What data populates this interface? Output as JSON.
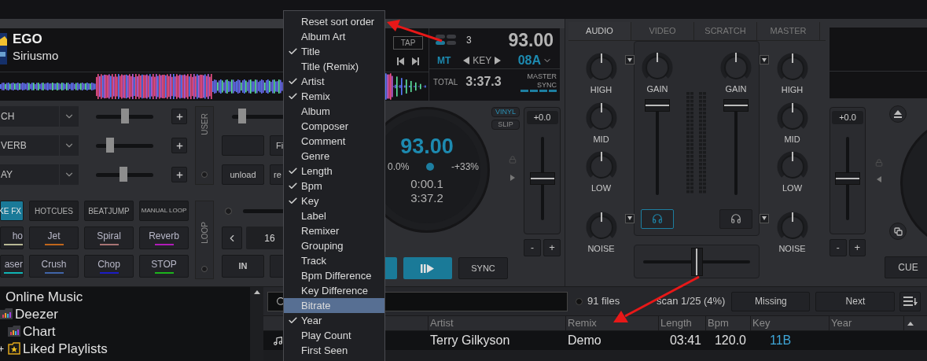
{
  "deck_left": {
    "title": "EGO",
    "artist": "Siriusmo",
    "tap": "TAP",
    "display": {
      "beats": "3",
      "bpm": "93.00",
      "mt": "MT",
      "key_label": "KEY",
      "key": "08A",
      "total_label": "TOTAL",
      "total": "3:37.3",
      "master_sync": "MASTER SYNC"
    },
    "fx_rows": [
      {
        "label": "CH",
        "level": 0.5
      },
      {
        "label": "VERB",
        "level": 0.2
      },
      {
        "label": "AY",
        "level": 0.47
      }
    ],
    "user_label": "USER",
    "side_slider": {
      "level": 0.05
    },
    "side_buttons": [
      "Fi",
      "unload",
      "re"
    ],
    "pad_modes": [
      {
        "label": "KE FX",
        "selected": true
      },
      {
        "label": "HOTCUES",
        "selected": false
      },
      {
        "label": "BEATJUMP",
        "selected": false
      },
      {
        "label": "MANUAL LOOP",
        "selected": false
      }
    ],
    "pads": [
      {
        "label": "ho",
        "color": "#b8b894"
      },
      {
        "label": "Jet",
        "color": "#c0661c"
      },
      {
        "label": "Spiral",
        "color": "#a87474"
      },
      {
        "label": "Reverb",
        "color": "#b01cb8"
      },
      {
        "label": "aser",
        "color": "#10b4b4"
      },
      {
        "label": "Crush",
        "color": "#4064a8"
      },
      {
        "label": "Chop",
        "color": "#1c1cc4"
      },
      {
        "label": "STOP",
        "color": "#1cb41c"
      }
    ],
    "loop_label": "LOOP",
    "loop_size": "16",
    "loop_in": "IN",
    "jog": {
      "bpm": "93.00",
      "pitch": "0.0%",
      "range": "-+33%",
      "elapsed": "0:00.1",
      "remain": "3:37.2"
    },
    "vinyl": {
      "label": "VINYL",
      "on": true
    },
    "slip": {
      "label": "SLIP",
      "on": false
    },
    "pitch": {
      "reading": "+0.0",
      "level": 0.5
    },
    "minus": "-",
    "plus": "+",
    "sync": "SYNC"
  },
  "mixer": {
    "tabs": [
      {
        "label": "AUDIO",
        "selected": true
      },
      {
        "label": "VIDEO",
        "selected": false
      },
      {
        "label": "SCRATCH",
        "selected": false
      },
      {
        "label": "MASTER",
        "selected": false
      }
    ],
    "eq_left": [
      "HIGH",
      "MID",
      "LOW",
      "NOISE"
    ],
    "eq_right": [
      "HIGH",
      "MID",
      "LOW",
      "NOISE"
    ],
    "channels": [
      {
        "gain_label": "GAIN",
        "level": 1,
        "headphones_on": true
      },
      {
        "gain_label": "GAIN",
        "level": 1,
        "headphones_on": false
      }
    ],
    "crossfader": {
      "level": 0.5
    }
  },
  "deck_right": {
    "pitch": {
      "reading": "+0.0",
      "level": 0.5
    },
    "minus": "-",
    "plus": "+",
    "cue": "CUE"
  },
  "browser": {
    "tree": [
      {
        "label": "Online Music",
        "children": [
          {
            "label": "Deezer",
            "kind": "chart-folder",
            "children": [
              {
                "label": "Chart",
                "kind": "chart-folder"
              },
              {
                "label": "Liked Playlists",
                "kind": "star-folder",
                "collapsed": true
              }
            ]
          }
        ]
      }
    ],
    "files": "91 files",
    "scan": "scan 1/25 (4%)",
    "buttons": [
      "Missing",
      "Next"
    ],
    "columns": [
      "Artist",
      "Remix",
      "Length",
      "Bpm",
      "Key",
      "Year"
    ],
    "rows": [
      {
        "artist": "Terry Gilkyson",
        "remix": "Demo",
        "length": "03:41",
        "bpm": "120.0",
        "key": "11B"
      }
    ]
  },
  "context_menu": {
    "items": [
      {
        "label": "Reset sort order",
        "checked": false,
        "selected": false
      },
      {
        "label": "Album Art",
        "checked": false,
        "selected": false
      },
      {
        "label": "Title",
        "checked": true,
        "selected": false
      },
      {
        "label": "Title (Remix)",
        "checked": false,
        "selected": false
      },
      {
        "label": "Artist",
        "checked": true,
        "selected": false
      },
      {
        "label": "Remix",
        "checked": true,
        "selected": false
      },
      {
        "label": "Album",
        "checked": false,
        "selected": false
      },
      {
        "label": "Composer",
        "checked": false,
        "selected": false
      },
      {
        "label": "Comment",
        "checked": false,
        "selected": false
      },
      {
        "label": "Genre",
        "checked": false,
        "selected": false
      },
      {
        "label": "Length",
        "checked": true,
        "selected": false
      },
      {
        "label": "Bpm",
        "checked": true,
        "selected": false
      },
      {
        "label": "Key",
        "checked": true,
        "selected": false
      },
      {
        "label": "Label",
        "checked": false,
        "selected": false
      },
      {
        "label": "Remixer",
        "checked": false,
        "selected": false
      },
      {
        "label": "Grouping",
        "checked": false,
        "selected": false
      },
      {
        "label": "Track",
        "checked": false,
        "selected": false
      },
      {
        "label": "Bpm Difference",
        "checked": false,
        "selected": false
      },
      {
        "label": "Key Difference",
        "checked": false,
        "selected": false
      },
      {
        "label": "Bitrate",
        "checked": false,
        "selected": true
      },
      {
        "label": "Year",
        "checked": true,
        "selected": false
      },
      {
        "label": "Play Count",
        "checked": false,
        "selected": false
      },
      {
        "label": "First Seen",
        "checked": false,
        "selected": false
      }
    ]
  }
}
